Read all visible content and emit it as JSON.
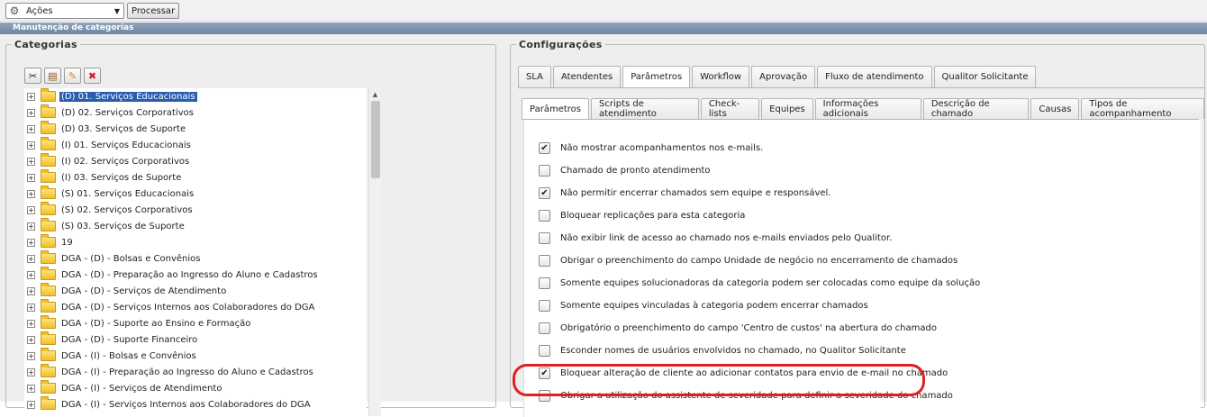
{
  "toolbar": {
    "actions_label": "Ações",
    "process_label": "Processar"
  },
  "window": {
    "title": "Manutenção de categorias"
  },
  "categories": {
    "legend": "Categorias",
    "items": [
      {
        "label": "(D) 01. Serviços Educacionais",
        "selected": true
      },
      {
        "label": "(D) 02. Serviços Corporativos"
      },
      {
        "label": "(D) 03. Serviços de Suporte"
      },
      {
        "label": "(I) 01. Serviços Educacionais"
      },
      {
        "label": "(I) 02. Serviços Corporativos"
      },
      {
        "label": "(I) 03. Serviços de Suporte"
      },
      {
        "label": "(S) 01. Serviços Educacionais"
      },
      {
        "label": "(S) 02. Serviços Corporativos"
      },
      {
        "label": "(S) 03. Serviços de Suporte"
      },
      {
        "label": "19"
      },
      {
        "label": "DGA - (D) - Bolsas e Convênios"
      },
      {
        "label": "DGA - (D) - Preparação ao Ingresso do Aluno e Cadastros"
      },
      {
        "label": "DGA - (D) - Serviços de Atendimento"
      },
      {
        "label": "DGA - (D) - Serviços Internos aos Colaboradores do DGA"
      },
      {
        "label": "DGA - (D) - Suporte ao Ensino e Formação"
      },
      {
        "label": "DGA - (D) - Suporte Financeiro"
      },
      {
        "label": "DGA - (I) - Bolsas e Convênios"
      },
      {
        "label": "DGA - (I) - Preparação ao Ingresso do Aluno e Cadastros"
      },
      {
        "label": "DGA - (I) - Serviços de Atendimento"
      },
      {
        "label": "DGA - (I) - Serviços Internos aos Colaboradores do DGA"
      }
    ]
  },
  "config": {
    "legend": "Configurações",
    "tabs": [
      "SLA",
      "Atendentes",
      "Parâmetros",
      "Workflow",
      "Aprovação",
      "Fluxo de atendimento",
      "Qualitor Solicitante"
    ],
    "active_tab": "Parâmetros",
    "subtabs": [
      "Parâmetros",
      "Scripts de atendimento",
      "Check-lists",
      "Equipes",
      "Informações adicionais",
      "Descrição de chamado",
      "Causas",
      "Tipos de acompanhamento"
    ],
    "active_subtab": "Parâmetros",
    "options": [
      {
        "label": "Não mostrar acompanhamentos nos e-mails.",
        "checked": true
      },
      {
        "label": "Chamado de pronto atendimento",
        "checked": false
      },
      {
        "label": "Não permitir encerrar chamados sem equipe e responsável.",
        "checked": true
      },
      {
        "label": "Bloquear replicações para esta categoria",
        "checked": false
      },
      {
        "label": "Não exibir link de acesso ao chamado nos e-mails enviados pelo Qualitor.",
        "checked": false
      },
      {
        "label": "Obrigar o preenchimento do campo Unidade de negócio no encerramento de chamados",
        "checked": false
      },
      {
        "label": "Somente equipes solucionadoras da categoria podem ser colocadas como equipe da solução",
        "checked": false
      },
      {
        "label": "Somente equipes vinculadas à categoria podem encerrar chamados",
        "checked": false
      },
      {
        "label": "Obrigatório o preenchimento do campo 'Centro de custos' na abertura do chamado",
        "checked": false
      },
      {
        "label": "Esconder nomes de usuários envolvidos no chamado, no Qualitor Solicitante",
        "checked": false
      },
      {
        "label": "Bloquear alteração de cliente ao adicionar contatos para envio de e-mail no chamado",
        "checked": true
      },
      {
        "label": "Obrigar a utilização do assistente de severidade para definir a severidade do chamado",
        "checked": false
      }
    ]
  },
  "colors": {
    "highlight": "#e02020",
    "selection": "#2a5db0"
  }
}
